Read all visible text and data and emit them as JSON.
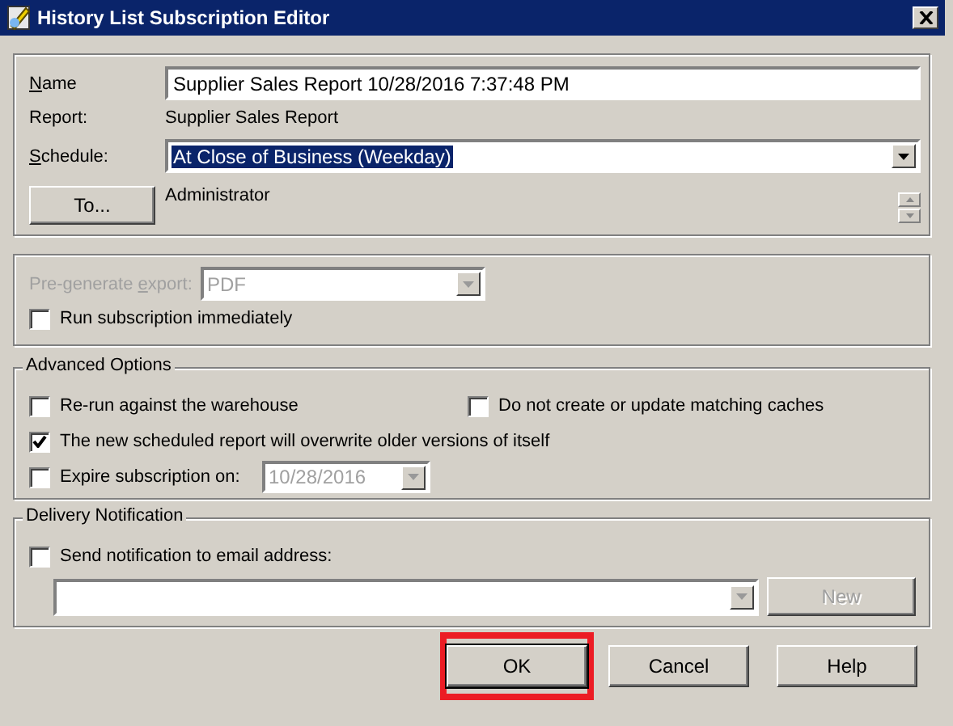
{
  "window": {
    "title": "History List Subscription Editor"
  },
  "general": {
    "name": {
      "label": [
        {
          "text": "N",
          "underlined": true
        },
        {
          "text": "ame",
          "underlined": false
        }
      ],
      "value": "Supplier Sales Report 10/28/2016 7:37:48 PM"
    },
    "report": {
      "label": "Report:",
      "value": "Supplier Sales Report"
    },
    "schedule": {
      "label": [
        {
          "text": "S",
          "underlined": true
        },
        {
          "text": "chedule:",
          "underlined": false
        }
      ],
      "value": "At Close of Business (Weekday)",
      "selected": true
    },
    "recipients": {
      "button": "To...",
      "value": "Administrator"
    }
  },
  "export": {
    "label": [
      {
        "text": "Pre-generate ",
        "underlined": false
      },
      {
        "text": "e",
        "underlined": true
      },
      {
        "text": "xport:",
        "underlined": false
      }
    ],
    "value": "PDF",
    "disabled": true,
    "options": [
      {
        "label": "Run subscription immediately",
        "checked": false
      }
    ]
  },
  "advanced": {
    "title": "Advanced Options",
    "rows": [
      [
        {
          "kind": "checkbox",
          "label": "Re-run against the warehouse",
          "checked": false
        },
        {
          "kind": "checkbox",
          "label": "Do not create or update matching caches",
          "checked": false
        }
      ],
      [
        {
          "kind": "checkbox",
          "label": "The new scheduled report will overwrite older versions of itself",
          "checked": true
        }
      ],
      [
        {
          "kind": "date",
          "label": "Expire subscription on:",
          "checked": false,
          "date": "10/28/2016",
          "disabled": true
        }
      ]
    ]
  },
  "delivery": {
    "title": "Delivery Notification",
    "option": {
      "label": "Send notification to email address:",
      "checked": false
    },
    "new_button": {
      "label": "New",
      "disabled": true
    }
  },
  "buttons": [
    {
      "label": "OK",
      "highlighted": true
    },
    {
      "label": "Cancel",
      "highlighted": false
    },
    {
      "label": "Help",
      "highlighted": false
    }
  ]
}
